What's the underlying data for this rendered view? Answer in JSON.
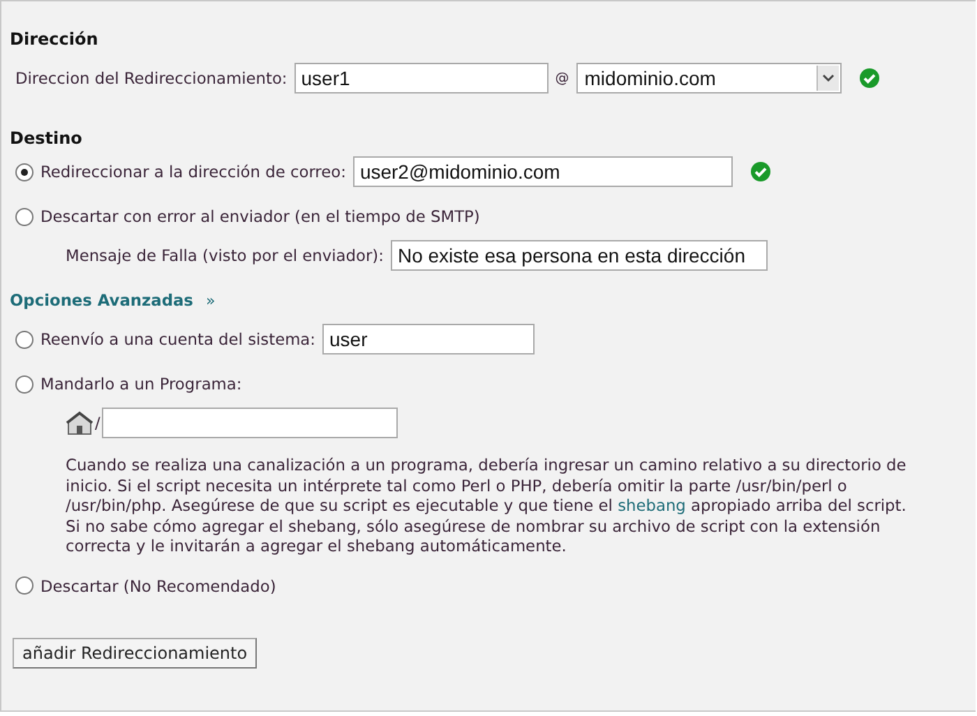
{
  "direccion": {
    "heading": "Dirección",
    "label": "Direccion del Redireccionamiento:",
    "user_value": "user1",
    "at": "@",
    "domain_value": "midominio.com",
    "valid": true
  },
  "destino": {
    "heading": "Destino",
    "options": [
      {
        "kind": "field",
        "label": "Redireccionar a la dirección de correo:",
        "value": "user2@midominio.com",
        "selected": true,
        "valid": true
      },
      {
        "kind": "sub",
        "label": "Descartar con error al enviador (en el tiempo de SMTP)",
        "selected": false,
        "sub_label": "Mensaje de Falla (visto por el enviador):",
        "sub_value": "No existe esa persona en esta dirección"
      }
    ]
  },
  "advanced": {
    "link": "Opciones Avanzadas",
    "arrow": "»",
    "options": [
      {
        "kind": "field",
        "label": "Reenvío a una cuenta del sistema:",
        "value": "user",
        "selected": false
      },
      {
        "kind": "program",
        "label": "Mandarlo a un Programa:",
        "selected": false,
        "path_prefix": "/",
        "help_before": "Cuando se realiza una canalización a un programa, debería ingresar un camino relativo a su directorio de inicio. Si el script necesita un intérprete tal como Perl o PHP, debería omitir la parte /usr/bin/perl o /usr/bin/php. Asegúrese de que su script es ejecutable y que tiene el",
        "help_link": "shebang",
        "help_after": "apropiado arriba del script. Si no sabe cómo agregar el shebang, sólo asegúrese de nombrar su archivo de script con la extensión correcta y le invitarán a agregar el shebang automáticamente."
      },
      {
        "kind": "plain",
        "label": "Descartar (No Recomendado)",
        "selected": false
      }
    ]
  },
  "submit": "añadir Redireccionamiento"
}
